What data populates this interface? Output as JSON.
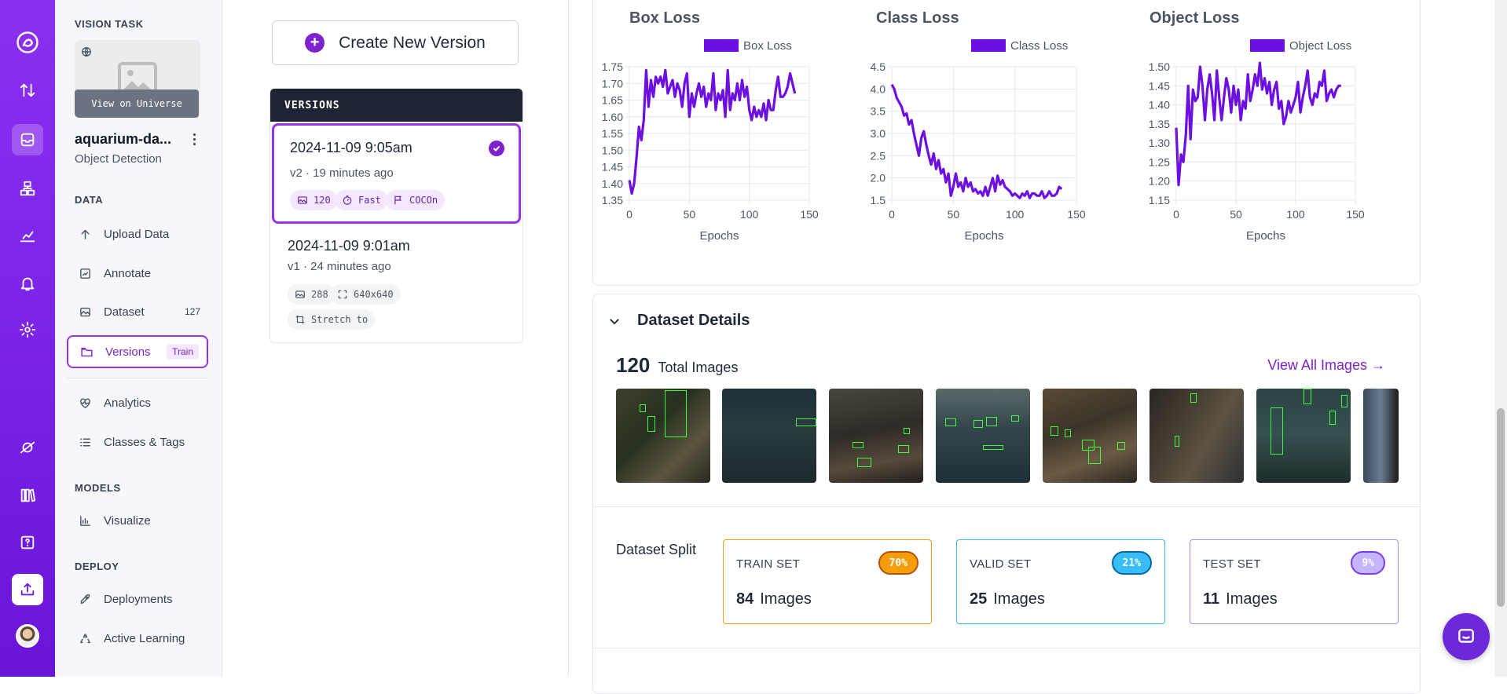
{
  "rail": {
    "items": [
      "logo-icon",
      "deploy-arrows-icon",
      "datasets-icon",
      "workflows-icon",
      "analytics-icon",
      "notifications-icon",
      "settings-icon",
      "universe-icon",
      "library-icon",
      "help-icon",
      "upload-icon",
      "avatar"
    ]
  },
  "sidebar": {
    "section_title": "VISION TASK",
    "view_universe": "View on Universe",
    "project_name": "aquarium-da...",
    "project_type": "Object Detection",
    "data_heading": "DATA",
    "models_heading": "MODELS",
    "deploy_heading": "DEPLOY",
    "items": {
      "upload": "Upload Data",
      "annotate": "Annotate",
      "dataset": "Dataset",
      "dataset_count": "127",
      "versions": "Versions",
      "versions_badge": "Train",
      "analytics": "Analytics",
      "classes": "Classes & Tags",
      "visualize": "Visualize",
      "deployments": "Deployments",
      "active_learning": "Active Learning"
    }
  },
  "versions": {
    "create_label": "Create New Version",
    "header": "VERSIONS",
    "list": [
      {
        "date": "2024-11-09 9:05am",
        "sub": "v2 · 19 minutes ago",
        "tags": [
          "120",
          "Fast",
          "COCOn"
        ]
      },
      {
        "date": "2024-11-09 9:01am",
        "sub": "v1 · 24 minutes ago",
        "tags": [
          "288",
          "640x640",
          "Stretch to"
        ]
      }
    ]
  },
  "chart_data": [
    {
      "type": "line",
      "title": "Box Loss",
      "xlabel": "Epochs",
      "ylabel": "",
      "legend": "Box Loss",
      "color": "#6d0fe0",
      "xlim": [
        0,
        150
      ],
      "ylim": [
        1.35,
        1.75
      ],
      "x": [
        0,
        2,
        4,
        6,
        8,
        10,
        12,
        14,
        16,
        18,
        20,
        22,
        24,
        26,
        28,
        30,
        32,
        34,
        36,
        38,
        40,
        42,
        44,
        46,
        48,
        50,
        52,
        54,
        56,
        58,
        60,
        62,
        64,
        66,
        68,
        70,
        72,
        74,
        76,
        78,
        80,
        82,
        84,
        86,
        88,
        90,
        92,
        94,
        96,
        98,
        100,
        102,
        104,
        106,
        108,
        110,
        112,
        114,
        116,
        118,
        120,
        122,
        124,
        126,
        128,
        130,
        132,
        134,
        136,
        138
      ],
      "y": [
        1.41,
        1.37,
        1.4,
        1.48,
        1.57,
        1.53,
        1.59,
        1.74,
        1.63,
        1.71,
        1.66,
        1.72,
        1.7,
        1.72,
        1.69,
        1.74,
        1.67,
        1.69,
        1.71,
        1.66,
        1.7,
        1.68,
        1.63,
        1.7,
        1.73,
        1.6,
        1.67,
        1.63,
        1.67,
        1.7,
        1.66,
        1.69,
        1.63,
        1.67,
        1.65,
        1.73,
        1.62,
        1.67,
        1.65,
        1.68,
        1.6,
        1.74,
        1.62,
        1.67,
        1.65,
        1.7,
        1.65,
        1.71,
        1.66,
        1.69,
        1.62,
        1.59,
        1.63,
        1.6,
        1.62,
        1.6,
        1.64,
        1.59,
        1.65,
        1.62,
        1.62,
        1.68,
        1.72,
        1.66,
        1.66,
        1.67,
        1.69,
        1.73,
        1.7,
        1.67
      ]
    },
    {
      "type": "line",
      "title": "Class Loss",
      "xlabel": "Epochs",
      "ylabel": "",
      "legend": "Class Loss",
      "color": "#6d0fe0",
      "xlim": [
        0,
        150
      ],
      "ylim": [
        1.5,
        4.5
      ],
      "x": [
        0,
        2,
        4,
        6,
        8,
        10,
        12,
        14,
        16,
        18,
        20,
        22,
        24,
        26,
        28,
        30,
        32,
        34,
        36,
        38,
        40,
        42,
        44,
        46,
        48,
        50,
        52,
        54,
        56,
        58,
        60,
        62,
        64,
        66,
        68,
        70,
        72,
        74,
        76,
        78,
        80,
        82,
        84,
        86,
        88,
        90,
        92,
        94,
        96,
        98,
        100,
        102,
        104,
        106,
        108,
        110,
        112,
        114,
        116,
        118,
        120,
        122,
        124,
        126,
        128,
        130,
        132,
        134,
        136,
        138
      ],
      "y": [
        4.1,
        4.0,
        3.8,
        3.7,
        3.6,
        3.4,
        3.45,
        3.2,
        3.3,
        3.0,
        2.75,
        2.5,
        2.9,
        3.05,
        2.75,
        2.5,
        2.3,
        2.55,
        2.2,
        2.4,
        2.1,
        2.2,
        1.9,
        2.1,
        1.6,
        1.8,
        2.1,
        1.8,
        1.9,
        1.7,
        2.0,
        1.8,
        1.9,
        1.7,
        1.75,
        1.65,
        1.7,
        1.6,
        1.8,
        1.6,
        1.8,
        2.0,
        1.7,
        2.05,
        1.85,
        1.95,
        1.8,
        1.75,
        1.7,
        1.6,
        1.65,
        1.6,
        1.55,
        1.65,
        1.6,
        1.7,
        1.55,
        1.65,
        1.65,
        1.6,
        1.6,
        1.7,
        1.55,
        1.6,
        1.7,
        1.6,
        1.6,
        1.65,
        1.8,
        1.75
      ]
    },
    {
      "type": "line",
      "title": "Object Loss",
      "xlabel": "Epochs",
      "ylabel": "",
      "legend": "Object Loss",
      "color": "#6d0fe0",
      "xlim": [
        0,
        150
      ],
      "ylim": [
        1.15,
        1.5
      ],
      "x": [
        0,
        2,
        4,
        6,
        8,
        10,
        12,
        14,
        16,
        18,
        20,
        22,
        24,
        26,
        28,
        30,
        32,
        34,
        36,
        38,
        40,
        42,
        44,
        46,
        48,
        50,
        52,
        54,
        56,
        58,
        60,
        62,
        64,
        66,
        68,
        70,
        72,
        74,
        76,
        78,
        80,
        82,
        84,
        86,
        88,
        90,
        92,
        94,
        96,
        98,
        100,
        102,
        104,
        106,
        108,
        110,
        112,
        114,
        116,
        118,
        120,
        122,
        124,
        126,
        128,
        130,
        132,
        134,
        136,
        138
      ],
      "y": [
        1.34,
        1.19,
        1.27,
        1.25,
        1.32,
        1.45,
        1.31,
        1.44,
        1.41,
        1.42,
        1.5,
        1.45,
        1.36,
        1.44,
        1.48,
        1.43,
        1.36,
        1.49,
        1.42,
        1.36,
        1.42,
        1.47,
        1.44,
        1.38,
        1.45,
        1.4,
        1.44,
        1.36,
        1.41,
        1.39,
        1.48,
        1.41,
        1.44,
        1.48,
        1.45,
        1.51,
        1.44,
        1.47,
        1.43,
        1.46,
        1.4,
        1.44,
        1.46,
        1.39,
        1.41,
        1.35,
        1.37,
        1.41,
        1.38,
        1.4,
        1.42,
        1.46,
        1.38,
        1.42,
        1.45,
        1.49,
        1.42,
        1.4,
        1.43,
        1.42,
        1.46,
        1.45,
        1.49,
        1.41,
        1.43,
        1.44,
        1.42,
        1.44,
        1.45,
        1.45
      ]
    }
  ],
  "details": {
    "title": "Dataset Details",
    "total_count": "120",
    "total_label": "Total Images",
    "view_all": "View All Images →",
    "split_label": "Dataset Split",
    "splits": [
      {
        "name": "TRAIN SET",
        "pct": "70%",
        "count": "84",
        "unit": "Images",
        "border": "#f59e0b",
        "pill_bg": "#f59e0b",
        "pill_border": "#b45309",
        "pill_fg": "#fff"
      },
      {
        "name": "VALID SET",
        "pct": "21%",
        "count": "25",
        "unit": "Images",
        "border": "#38bdf8",
        "pill_bg": "#38bdf8",
        "pill_border": "#0369a1",
        "pill_fg": "#fff"
      },
      {
        "name": "TEST SET",
        "pct": "9%",
        "count": "11",
        "unit": "Images",
        "border": "#a78bfa",
        "pill_bg": "#c4b5fd",
        "pill_border": "#7c3aed",
        "pill_fg": "#fff"
      }
    ]
  }
}
